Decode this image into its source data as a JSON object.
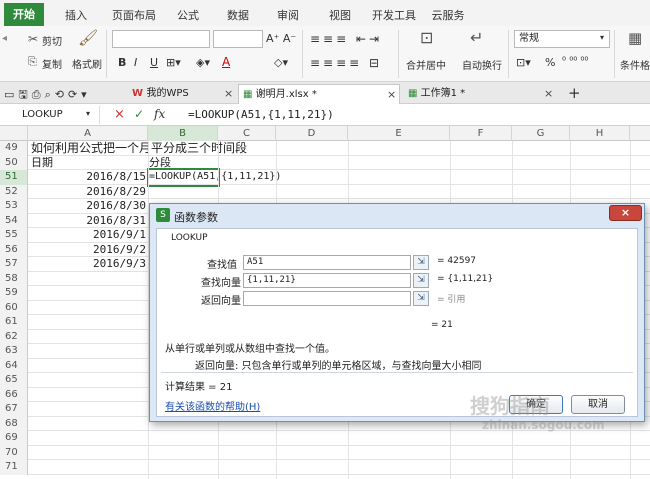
{
  "ribbon_tabs": [
    "开始",
    "插入",
    "页面布局",
    "公式",
    "数据",
    "审阅",
    "视图",
    "开发工具",
    "云服务"
  ],
  "ribbon": {
    "cut": "剪切",
    "copy": "复制",
    "format_painter": "格式刷",
    "merge_center": "合并居中",
    "wrap_text": "自动换行",
    "number_format": "常规",
    "percent": "%",
    "conditional_format": "条件格"
  },
  "doc_tabs": [
    "我的WPS",
    "谢明月.xlsx *",
    "工作簿1 *"
  ],
  "name_box": "LOOKUP",
  "formula": "=LOOKUP(A51,{1,11,21})",
  "columns": [
    "A",
    "B",
    "C",
    "D",
    "E",
    "F",
    "G",
    "H"
  ],
  "rows": [
    {
      "n": "49",
      "a": "如何利用公式把一个月平分成三个时间段",
      "b": ""
    },
    {
      "n": "50",
      "a": "日期",
      "b": "分段"
    },
    {
      "n": "51",
      "a": "2016/8/15",
      "b": "=LOOKUP(A51,{1,11,21})"
    },
    {
      "n": "52",
      "a": "2016/8/29",
      "b": ""
    },
    {
      "n": "53",
      "a": "2016/8/30",
      "b": ""
    },
    {
      "n": "54",
      "a": "2016/8/31",
      "b": ""
    },
    {
      "n": "55",
      "a": "2016/9/1",
      "b": ""
    },
    {
      "n": "56",
      "a": "2016/9/2",
      "b": ""
    },
    {
      "n": "57",
      "a": "2016/9/3",
      "b": ""
    },
    {
      "n": "58",
      "a": "",
      "b": ""
    },
    {
      "n": "59",
      "a": "",
      "b": ""
    },
    {
      "n": "60",
      "a": "",
      "b": ""
    },
    {
      "n": "61",
      "a": "",
      "b": ""
    },
    {
      "n": "62",
      "a": "",
      "b": ""
    },
    {
      "n": "63",
      "a": "",
      "b": ""
    },
    {
      "n": "64",
      "a": "",
      "b": ""
    },
    {
      "n": "65",
      "a": "",
      "b": ""
    },
    {
      "n": "66",
      "a": "",
      "b": ""
    },
    {
      "n": "67",
      "a": "",
      "b": ""
    },
    {
      "n": "68",
      "a": "",
      "b": ""
    },
    {
      "n": "69",
      "a": "",
      "b": ""
    },
    {
      "n": "70",
      "a": "",
      "b": ""
    },
    {
      "n": "71",
      "a": "",
      "b": ""
    }
  ],
  "dialog": {
    "title": "函数参数",
    "function_name": "LOOKUP",
    "params": [
      {
        "label": "查找值",
        "value": "A51",
        "result": "= 42597"
      },
      {
        "label": "查找向量",
        "value": "{1,11,21}",
        "result": "= {1,11,21}"
      },
      {
        "label": "返回向量",
        "value": "",
        "result": "= 引用"
      }
    ],
    "formula_result": "= 21",
    "description": "从单行或单列或从数组中查找一个值。",
    "arg_help": "返回向量:  只包含单行或单列的单元格区域，与查找向量大小相同",
    "calc_result": "计算结果 = 21",
    "help_link": "有关该函数的帮助(H)",
    "ok": "确定",
    "cancel": "取消"
  },
  "watermark": {
    "brand": "搜狗指南",
    "url": "zhinan.sogou.com"
  }
}
